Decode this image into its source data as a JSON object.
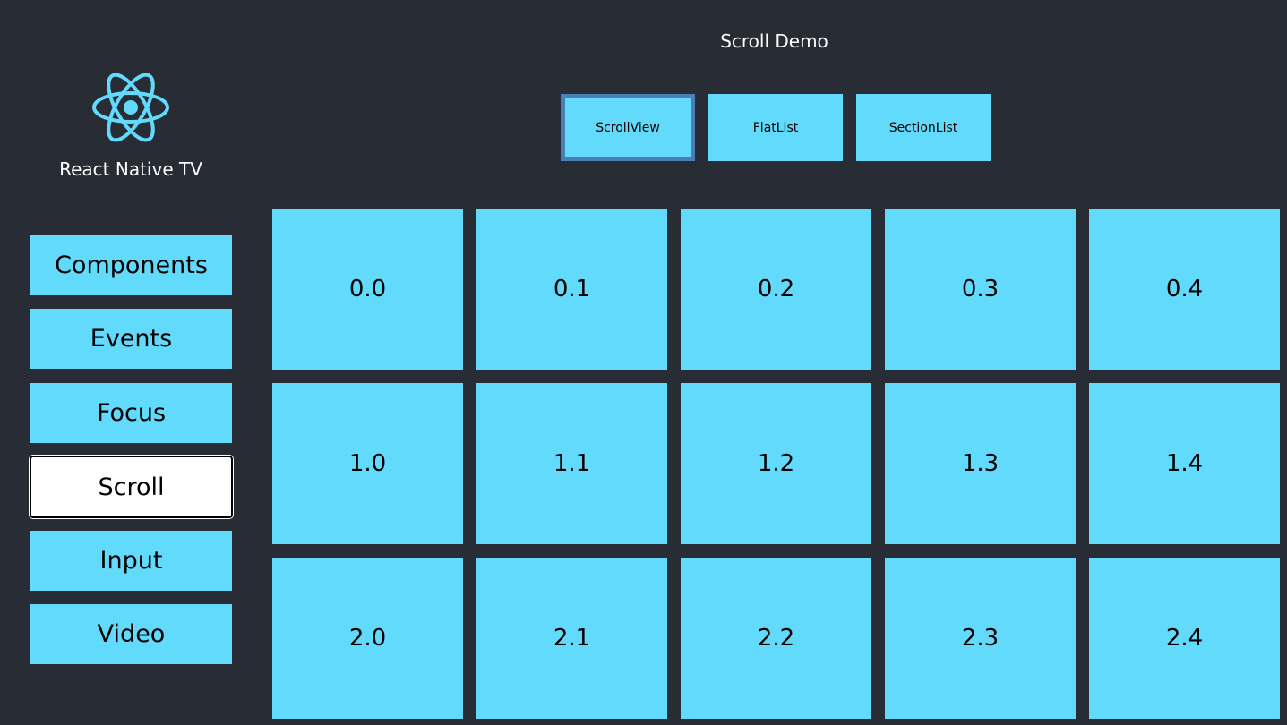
{
  "sidebar": {
    "app_title": "React Native TV",
    "logo_icon": "react-atom-icon",
    "items": [
      {
        "label": "Components"
      },
      {
        "label": "Events"
      },
      {
        "label": "Focus"
      },
      {
        "label": "Scroll"
      },
      {
        "label": "Input"
      },
      {
        "label": "Video"
      }
    ],
    "selected": "Scroll"
  },
  "main": {
    "title": "Scroll Demo",
    "tabs": [
      {
        "label": "ScrollView"
      },
      {
        "label": "FlatList"
      },
      {
        "label": "SectionList"
      }
    ],
    "selected_tab": "ScrollView",
    "grid": [
      [
        "0.0",
        "0.1",
        "0.2",
        "0.3",
        "0.4"
      ],
      [
        "1.0",
        "1.1",
        "1.2",
        "1.3",
        "1.4"
      ],
      [
        "2.0",
        "2.1",
        "2.2",
        "2.3",
        "2.4"
      ]
    ]
  },
  "colors": {
    "background": "#282c34",
    "accent": "#61dafb",
    "focus_border": "#4a7fb5"
  }
}
